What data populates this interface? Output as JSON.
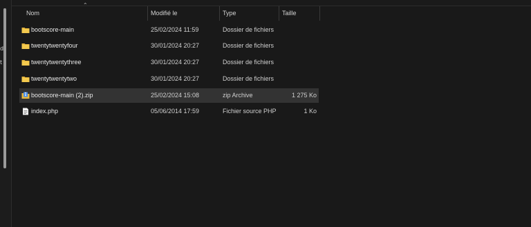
{
  "columns": {
    "name": "Nom",
    "modified": "Modifié le",
    "type": "Type",
    "size": "Taille"
  },
  "files": [
    {
      "name": "bootscore-main",
      "modified": "25/02/2024 11:59",
      "type": "Dossier de fichiers",
      "size": "",
      "icon": "folder-icon"
    },
    {
      "name": "twentytwentyfour",
      "modified": "30/01/2024 20:27",
      "type": "Dossier de fichiers",
      "size": "",
      "icon": "folder-icon"
    },
    {
      "name": "twentytwentythree",
      "modified": "30/01/2024 20:27",
      "type": "Dossier de fichiers",
      "size": "",
      "icon": "folder-icon"
    },
    {
      "name": "twentytwentytwo",
      "modified": "30/01/2024 20:27",
      "type": "Dossier de fichiers",
      "size": "",
      "icon": "folder-icon"
    },
    {
      "name": "bootscore-main (2).zip",
      "modified": "25/02/2024 15:08",
      "type": "zip Archive",
      "size": "1 275 Ko",
      "icon": "zip-archive-icon",
      "selected": true
    },
    {
      "name": "index.php",
      "modified": "05/06/2014 17:59",
      "type": "Fichier source PHP",
      "size": "1 Ko",
      "icon": "php-file-icon"
    }
  ],
  "colors": {
    "background": "#191919",
    "selected_row": "#333333",
    "folder": "#e8b83e"
  }
}
